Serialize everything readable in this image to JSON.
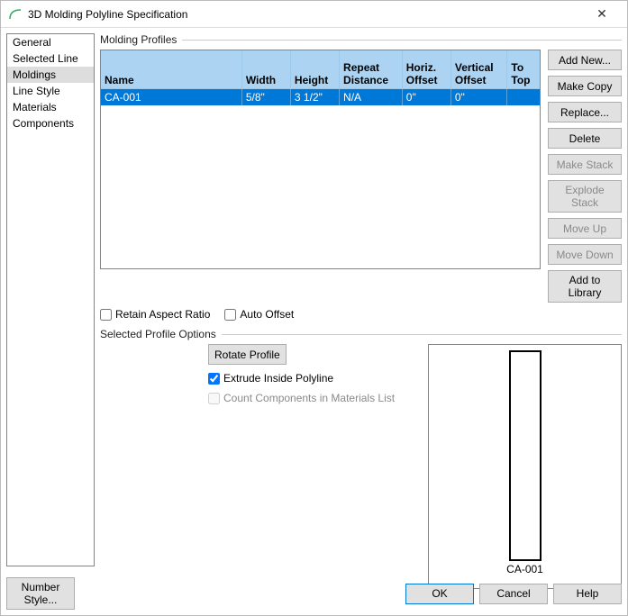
{
  "window": {
    "title": "3D Molding Polyline Specification"
  },
  "sidebar": {
    "items": [
      "General",
      "Selected Line",
      "Moldings",
      "Line Style",
      "Materials",
      "Components"
    ],
    "selected_index": 2,
    "number_style_label": "Number Style..."
  },
  "molding": {
    "group_title": "Molding Profiles",
    "columns": [
      "Name",
      "Width",
      "Height",
      "Repeat Distance",
      "Horiz. Offset",
      "Vertical Offset",
      "To Top"
    ],
    "row": {
      "name": "CA-001",
      "width": "5/8\"",
      "height": "3 1/2\"",
      "repeat": "N/A",
      "hoff": "0\"",
      "voff": "0\"",
      "totop": ""
    },
    "retain_label": "Retain Aspect Ratio",
    "auto_offset_label": "Auto Offset"
  },
  "side_buttons": {
    "add_new": "Add New...",
    "make_copy": "Make Copy",
    "replace": "Replace...",
    "delete": "Delete",
    "make_stack": "Make Stack",
    "explode_stack": "Explode Stack",
    "move_up": "Move Up",
    "move_down": "Move Down",
    "add_to_library": "Add to Library"
  },
  "options": {
    "group_title": "Selected Profile Options",
    "rotate_label": "Rotate Profile",
    "extrude_label": "Extrude Inside Polyline",
    "count_label": "Count Components in Materials List",
    "preview_label": "CA-001"
  },
  "footer": {
    "ok": "OK",
    "cancel": "Cancel",
    "help": "Help"
  }
}
